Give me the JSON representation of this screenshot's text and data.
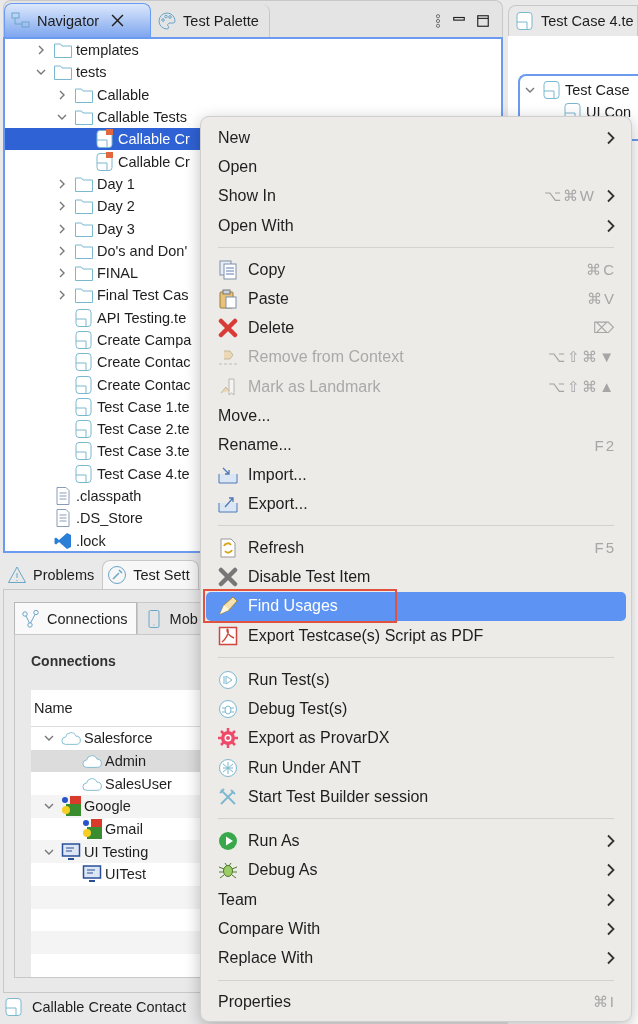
{
  "navigator": {
    "tabs": [
      {
        "label": "Navigator",
        "selected": true,
        "closable": true
      },
      {
        "label": "Test Palette",
        "selected": false,
        "closable": false
      }
    ],
    "tree": [
      {
        "label": "templates",
        "kind": "folder",
        "expanded": false,
        "selected": false
      },
      {
        "label": "tests",
        "kind": "folder",
        "expanded": true,
        "selected": false,
        "children": [
          {
            "label": "Callable",
            "kind": "folder",
            "expanded": false,
            "selected": false
          },
          {
            "label": "Callable Tests",
            "kind": "folder",
            "expanded": true,
            "selected": false,
            "children": [
              {
                "label": "Callable Cr",
                "kind": "callable",
                "selected": true
              },
              {
                "label": "Callable Cr",
                "kind": "callable",
                "selected": false
              }
            ]
          },
          {
            "label": "Day 1",
            "kind": "folder",
            "expanded": false,
            "selected": false
          },
          {
            "label": "Day 2",
            "kind": "folder",
            "expanded": false,
            "selected": false
          },
          {
            "label": "Day 3",
            "kind": "folder",
            "expanded": false,
            "selected": false
          },
          {
            "label": "Do's and Don'",
            "kind": "folder",
            "expanded": false,
            "selected": false
          },
          {
            "label": "FINAL",
            "kind": "folder",
            "expanded": false,
            "selected": false
          },
          {
            "label": "Final Test Cas",
            "kind": "folder",
            "expanded": false,
            "selected": false
          },
          {
            "label": "API Testing.te",
            "kind": "test",
            "selected": false
          },
          {
            "label": "Create Campa",
            "kind": "test",
            "selected": false
          },
          {
            "label": "Create Contac",
            "kind": "test",
            "selected": false
          },
          {
            "label": "Create Contac",
            "kind": "test",
            "selected": false
          },
          {
            "label": "Test Case 1.te",
            "kind": "test",
            "selected": false
          },
          {
            "label": "Test Case 2.te",
            "kind": "test",
            "selected": false
          },
          {
            "label": "Test Case 3.te",
            "kind": "test",
            "selected": false
          },
          {
            "label": "Test Case 4.te",
            "kind": "test",
            "selected": false
          }
        ]
      },
      {
        "label": ".classpath",
        "kind": "file",
        "selected": false
      },
      {
        "label": ".DS_Store",
        "kind": "file",
        "selected": false
      },
      {
        "label": ".lock",
        "kind": "vscode",
        "selected": false
      }
    ]
  },
  "bottom_panel": {
    "tabs": [
      {
        "label": "Problems",
        "kind": "warning",
        "selected": false
      },
      {
        "label": "Test Sett",
        "kind": "wrench",
        "selected": true
      }
    ],
    "inner_tabs": [
      {
        "label": "Connections",
        "kind": "connections",
        "selected": true
      },
      {
        "label": "Mob",
        "kind": "mobile",
        "selected": false
      }
    ],
    "section_title": "Connections",
    "table": {
      "columns": [
        "Name"
      ],
      "rows": [
        {
          "label": "Salesforce",
          "kind": "cloud",
          "expanded": true,
          "selected": false,
          "children": [
            {
              "label": "Admin",
              "kind": "cloud",
              "selected": true
            },
            {
              "label": "SalesUser",
              "kind": "cloud",
              "selected": false
            }
          ]
        },
        {
          "label": "Google",
          "kind": "google",
          "expanded": true,
          "selected": false,
          "children": [
            {
              "label": "Gmail",
              "kind": "google",
              "selected": false
            }
          ]
        },
        {
          "label": "UI Testing",
          "kind": "monitor",
          "expanded": true,
          "selected": false,
          "children": [
            {
              "label": "UITest",
              "kind": "monitor",
              "selected": false
            }
          ]
        }
      ]
    }
  },
  "status_bar": {
    "text": "Callable Create Contact"
  },
  "editor": {
    "tab": "Test Case 4.te",
    "tree": [
      {
        "label": "Test Case",
        "expanded": true,
        "children": [
          {
            "label": "UI Con"
          }
        ]
      }
    ]
  },
  "context_menu": {
    "groups": [
      [
        {
          "label": "New",
          "submenu": true,
          "disabled": false,
          "selected": false,
          "outlined": false
        },
        {
          "label": "Open",
          "submenu": false,
          "disabled": false,
          "selected": false,
          "outlined": false
        },
        {
          "label": "Show In",
          "shortcut": "⌥⌘W",
          "submenu": true,
          "disabled": false,
          "selected": false,
          "outlined": false
        },
        {
          "label": "Open With",
          "submenu": true,
          "disabled": false,
          "selected": false,
          "outlined": false
        }
      ],
      [
        {
          "label": "Copy",
          "shortcut": "⌘C",
          "submenu": false,
          "disabled": false,
          "selected": false,
          "outlined": false
        },
        {
          "label": "Paste",
          "shortcut": "⌘V",
          "submenu": false,
          "disabled": false,
          "selected": false,
          "outlined": false
        },
        {
          "label": "Delete",
          "shortcut": "⌦",
          "submenu": false,
          "disabled": false,
          "selected": false,
          "outlined": false
        },
        {
          "label": "Remove from Context",
          "shortcut": "⌥⇧⌘▼",
          "submenu": false,
          "disabled": true,
          "selected": false,
          "outlined": false
        },
        {
          "label": "Mark as Landmark",
          "shortcut": "⌥⇧⌘▲",
          "submenu": false,
          "disabled": true,
          "selected": false,
          "outlined": false
        },
        {
          "label": "Move...",
          "submenu": false,
          "disabled": false,
          "selected": false,
          "outlined": false
        },
        {
          "label": "Rename...",
          "shortcut": "F2",
          "submenu": false,
          "disabled": false,
          "selected": false,
          "outlined": false
        },
        {
          "label": "Import...",
          "submenu": false,
          "disabled": false,
          "selected": false,
          "outlined": false
        },
        {
          "label": "Export...",
          "submenu": false,
          "disabled": false,
          "selected": false,
          "outlined": false
        }
      ],
      [
        {
          "label": "Refresh",
          "shortcut": "F5",
          "submenu": false,
          "disabled": false,
          "selected": false,
          "outlined": false
        },
        {
          "label": "Disable Test Item",
          "submenu": false,
          "disabled": false,
          "selected": false,
          "outlined": false
        },
        {
          "label": "Find Usages",
          "submenu": false,
          "disabled": false,
          "selected": true,
          "outlined": true
        },
        {
          "label": "Export Testcase(s) Script as PDF",
          "submenu": false,
          "disabled": false,
          "selected": false,
          "outlined": false
        }
      ],
      [
        {
          "label": "Run Test(s)",
          "submenu": false,
          "disabled": false,
          "selected": false,
          "outlined": false
        },
        {
          "label": "Debug Test(s)",
          "submenu": false,
          "disabled": false,
          "selected": false,
          "outlined": false
        },
        {
          "label": "Export as ProvarDX",
          "submenu": false,
          "disabled": false,
          "selected": false,
          "outlined": false
        },
        {
          "label": "Run Under ANT",
          "submenu": false,
          "disabled": false,
          "selected": false,
          "outlined": false
        },
        {
          "label": "Start Test Builder session",
          "submenu": false,
          "disabled": false,
          "selected": false,
          "outlined": false
        }
      ],
      [
        {
          "label": "Run As",
          "submenu": true,
          "disabled": false,
          "selected": false,
          "outlined": false
        },
        {
          "label": "Debug As",
          "submenu": true,
          "disabled": false,
          "selected": false,
          "outlined": false
        },
        {
          "label": "Team",
          "submenu": true,
          "disabled": false,
          "selected": false,
          "outlined": false
        },
        {
          "label": "Compare With",
          "submenu": true,
          "disabled": false,
          "selected": false,
          "outlined": false
        },
        {
          "label": "Replace With",
          "submenu": true,
          "disabled": false,
          "selected": false,
          "outlined": false
        }
      ],
      [
        {
          "label": "Properties",
          "shortcut": "⌘I",
          "submenu": false,
          "disabled": false,
          "selected": false,
          "outlined": false
        }
      ]
    ]
  }
}
